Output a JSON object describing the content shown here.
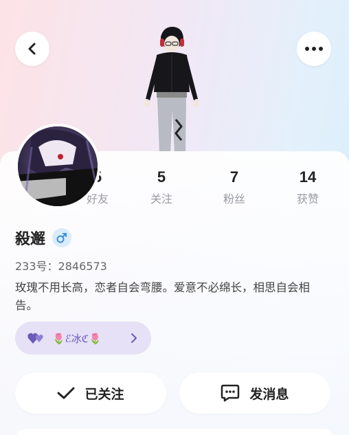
{
  "header": {
    "back_icon": "chevron-left-icon",
    "more_icon": "more-horizontal-icon"
  },
  "stats": [
    {
      "value": "5",
      "label": "好友"
    },
    {
      "value": "5",
      "label": "关注"
    },
    {
      "value": "7",
      "label": "粉丝"
    },
    {
      "value": "14",
      "label": "获赞"
    }
  ],
  "profile": {
    "name": "殺邂",
    "gender_symbol": "♂",
    "uid": "233号：2846573",
    "bio": "玫瑰不用长高，恋者自会弯腰。爱意不必绵长，相思自会相告。",
    "tag_text": "🌷ℰ冰ℭ🌷"
  },
  "actions": {
    "follow_label": "已关注",
    "message_label": "发消息"
  },
  "colors": {
    "accent_purple": "#6a5bb8",
    "gender_bg": "#d9ecfb",
    "gender_fg": "#3b8fd6"
  }
}
